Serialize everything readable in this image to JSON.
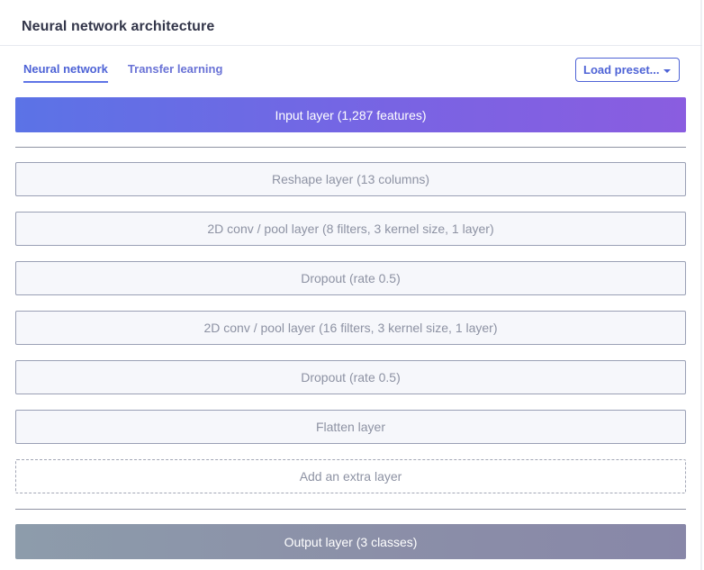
{
  "header": {
    "title": "Neural network architecture"
  },
  "tabs": [
    {
      "label": "Neural network",
      "active": true
    },
    {
      "label": "Transfer learning",
      "active": false
    }
  ],
  "preset": {
    "label": "Load preset..."
  },
  "input_layer": {
    "label": "Input layer (1,287 features)"
  },
  "layers": [
    {
      "label": "Reshape layer (13 columns)"
    },
    {
      "label": "2D conv / pool layer (8 filters, 3 kernel size, 1 layer)"
    },
    {
      "label": "Dropout (rate 0.5)"
    },
    {
      "label": "2D conv / pool layer (16 filters, 3 kernel size, 1 layer)"
    },
    {
      "label": "Dropout (rate 0.5)"
    },
    {
      "label": "Flatten layer"
    }
  ],
  "add_layer": {
    "label": "Add an extra layer"
  },
  "output_layer": {
    "label": "Output layer (3 classes)"
  },
  "colors": {
    "accent": "#4e63d6",
    "input_gradient_start": "#5b73e6",
    "input_gradient_end": "#8a5de0",
    "output_gradient_start": "#8d9cab",
    "output_gradient_end": "#8887a8"
  }
}
